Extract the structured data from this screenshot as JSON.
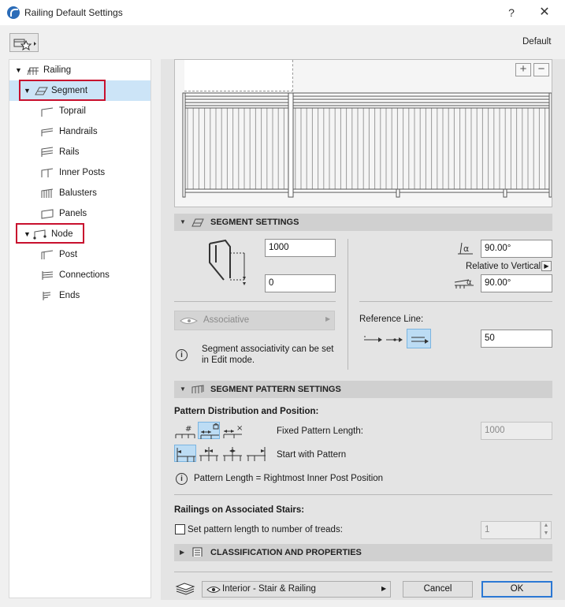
{
  "window": {
    "title": "Railing Default Settings",
    "help_glyph": "?",
    "close_glyph": "✕",
    "default_label": "Default"
  },
  "tree": {
    "items": [
      {
        "label": "Railing",
        "level": 0,
        "expanded": true
      },
      {
        "label": "Segment",
        "level": 1,
        "expanded": true,
        "selected": true
      },
      {
        "label": "Toprail",
        "level": 2
      },
      {
        "label": "Handrails",
        "level": 2
      },
      {
        "label": "Rails",
        "level": 2
      },
      {
        "label": "Inner Posts",
        "level": 2
      },
      {
        "label": "Balusters",
        "level": 2
      },
      {
        "label": "Panels",
        "level": 2
      },
      {
        "label": "Node",
        "level": 1,
        "expanded": true
      },
      {
        "label": "Post",
        "level": 2
      },
      {
        "label": "Connections",
        "level": 2
      },
      {
        "label": "Ends",
        "level": 2
      }
    ]
  },
  "preview": {
    "zoom_in": "+",
    "zoom_out": "−"
  },
  "segment_settings": {
    "title": "SEGMENT SETTINGS",
    "height_value": "1000",
    "offset_value": "0",
    "angle_top_value": "90.00°",
    "relative_label": "Relative to Vertical",
    "angle_bottom_value": "90.00°",
    "associative_label": "Associative",
    "info_text_line1": "Segment associativity can be set",
    "info_text_line2": "in Edit mode.",
    "reference_line_label": "Reference Line:",
    "reference_value": "50"
  },
  "pattern_settings": {
    "title": "SEGMENT PATTERN SETTINGS",
    "distribution_label": "Pattern Distribution and Position:",
    "fixed_length_label": "Fixed Pattern Length:",
    "fixed_length_value": "1000",
    "start_label": "Start with Pattern",
    "pattern_length_info": "Pattern Length = Rightmost Inner Post Position",
    "stairs_label": "Railings on Associated Stairs:",
    "set_pattern_checkbox_label": "Set pattern length to number of treads:",
    "treads_value": "1"
  },
  "classification": {
    "title": "CLASSIFICATION AND PROPERTIES"
  },
  "footer": {
    "layer_value": "Interior - Stair & Railing",
    "cancel_label": "Cancel",
    "ok_label": "OK"
  },
  "colors": {
    "selection": "#cce4f7",
    "highlight_box": "#c8102e",
    "section_header": "#d0d0d0",
    "accent_button": "#2b78d4"
  }
}
